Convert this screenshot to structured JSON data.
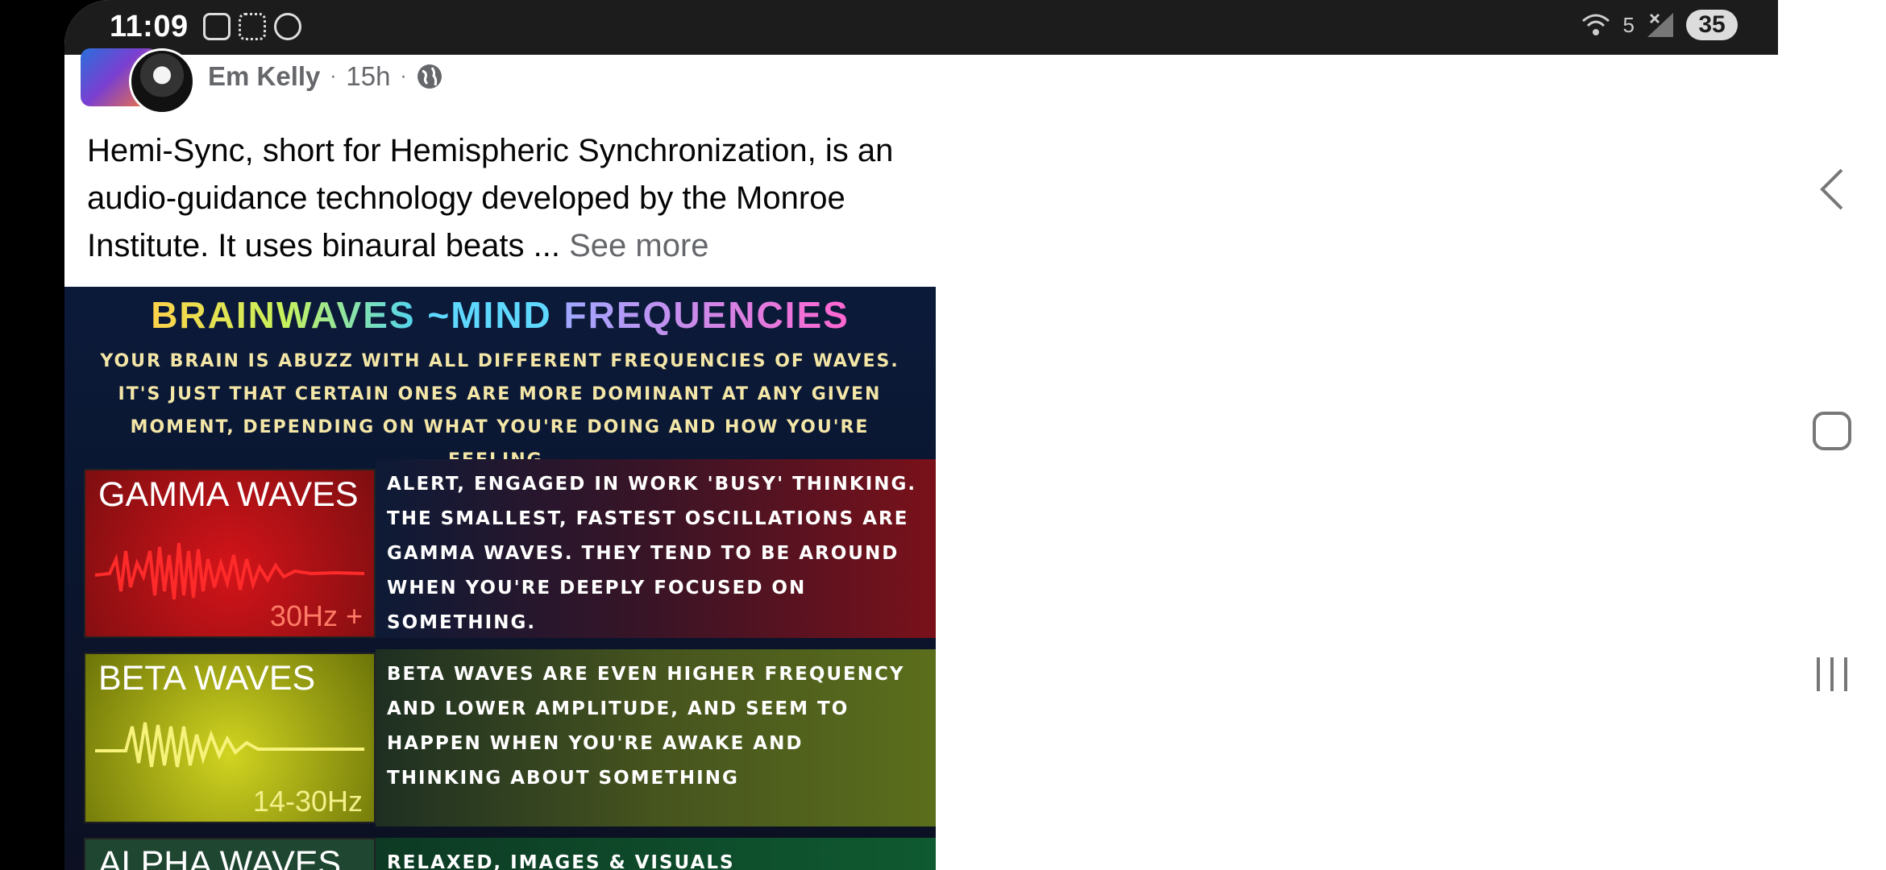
{
  "status_bar": {
    "time": "11:09",
    "battery": "35",
    "wifi_label": "5"
  },
  "post": {
    "author": "Em Kelly",
    "time_ago": "15h",
    "caption": "Hemi-Sync, short for Hemispheric Synchronization, is an audio-guidance technology developed by the Monroe Institute. It uses binaural beats ...",
    "see_more": "See more"
  },
  "image": {
    "title_part1": "BRAINWAVES",
    "title_part2": "~MIND",
    "title_part3": "FREQUENCIES",
    "intro": "YOUR BRAIN IS ABUZZ WITH ALL DIFFERENT FREQUENCIES OF WAVES. IT'S JUST THAT CERTAIN ONES ARE MORE DOMINANT AT ANY GIVEN MOMENT, DEPENDING ON WHAT YOU'RE DOING AND HOW YOU'RE FEELING.",
    "waves": {
      "gamma": {
        "name": "GAMMA WAVES",
        "hz": "30Hz +",
        "description": "ALERT, ENGAGED IN WORK 'BUSY' THINKING. THE SMALLEST, FASTEST OSCILLATIONS ARE GAMMA WAVES. THEY TEND TO BE AROUND WHEN YOU'RE DEEPLY FOCUSED ON SOMETHING."
      },
      "beta": {
        "name": "BETA WAVES",
        "hz": "14-30Hz",
        "description": "BETA WAVES ARE EVEN HIGHER FREQUENCY AND LOWER AMPLITUDE, AND SEEM TO HAPPEN WHEN YOU'RE AWAKE AND THINKING ABOUT SOMETHING"
      },
      "alpha": {
        "name": "ALPHA WAVES",
        "description": "RELAXED, IMAGES & VISUALS"
      }
    }
  },
  "colors": {
    "statusbar_bg": "#1c1c1c",
    "meta_gray": "#65676b",
    "gamma_red": "#d4141a",
    "beta_yellow": "#d1d420"
  }
}
